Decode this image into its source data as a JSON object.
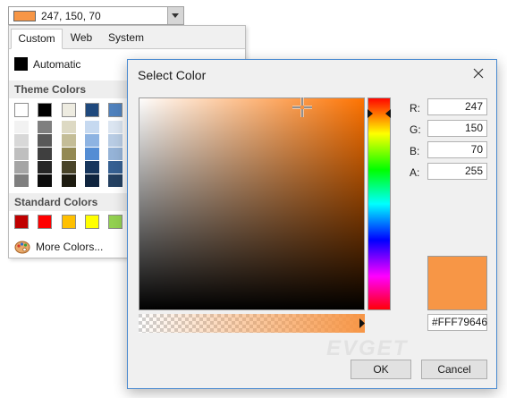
{
  "combo": {
    "value_text": "247, 150, 70",
    "swatch": "#F79646"
  },
  "panel": {
    "tabs": [
      "Custom",
      "Web",
      "System"
    ],
    "active_tab": "Custom",
    "automatic_label": "Automatic",
    "theme_title": "Theme Colors",
    "standard_title": "Standard Colors",
    "more_label": "More Colors...",
    "theme_top": [
      "#FFFFFF",
      "#000000",
      "#EEECE1",
      "#1F497D",
      "#4F81BD"
    ],
    "theme_shades": [
      [
        "#F2F2F2",
        "#D8D8D8",
        "#BFBFBF",
        "#A5A5A5",
        "#7F7F7F"
      ],
      [
        "#7F7F7F",
        "#595959",
        "#3F3F3F",
        "#262626",
        "#0C0C0C"
      ],
      [
        "#DDD9C3",
        "#C4BD97",
        "#938953",
        "#494429",
        "#1D1B10"
      ],
      [
        "#C6D9F0",
        "#8DB3E2",
        "#548DD4",
        "#17365D",
        "#0F243E"
      ],
      [
        "#DBE5F1",
        "#B8CCE4",
        "#95B3D7",
        "#366092",
        "#244061"
      ]
    ],
    "standard": [
      "#C00000",
      "#FF0000",
      "#FFC000",
      "#FFFF00",
      "#92D050"
    ]
  },
  "dialog": {
    "title": "Select Color",
    "r_label": "R:",
    "g_label": "G:",
    "b_label": "B:",
    "a_label": "A:",
    "r": "247",
    "g": "150",
    "b": "70",
    "a": "255",
    "hex": "#FFF79646",
    "ok": "OK",
    "cancel": "Cancel",
    "color": "#F79646"
  },
  "watermark": "EVGET"
}
